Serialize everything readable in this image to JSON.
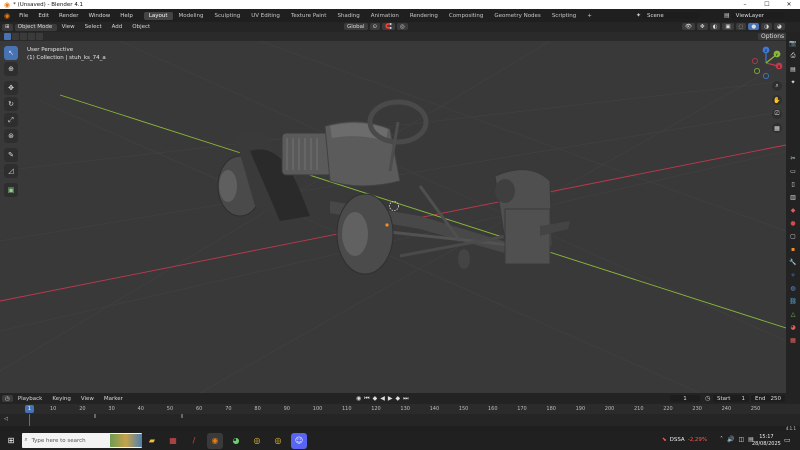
{
  "window": {
    "title": "* (Unsaved) - Blender 4.1",
    "controls": [
      "–",
      "☐",
      "✕"
    ]
  },
  "menubar": {
    "menus": [
      "File",
      "Edit",
      "Render",
      "Window",
      "Help"
    ],
    "workspaces": [
      "Layout",
      "Modeling",
      "Sculpting",
      "UV Editing",
      "Texture Paint",
      "Shading",
      "Animation",
      "Rendering",
      "Compositing",
      "Geometry Nodes",
      "Scripting"
    ],
    "active_workspace": "Layout",
    "add_tab": "+",
    "scene_label": "Scene",
    "view_layer_label": "ViewLayer"
  },
  "header3d": {
    "mode": "Object Mode",
    "menus": [
      "View",
      "Select",
      "Add",
      "Object"
    ],
    "orientation": "Global",
    "options_label": "Options"
  },
  "viewport": {
    "view_name": "User Perspective",
    "collection_info": "(1) Collection | stuh_ks_74_a",
    "nav_axes": [
      "X",
      "Y",
      "Z"
    ]
  },
  "timeline": {
    "menus": [
      "Playback",
      "Keying",
      "View",
      "Marker"
    ],
    "current_frame": "1",
    "start_label": "Start",
    "start_value": "1",
    "end_label": "End",
    "end_value": "250",
    "frame_marker": "1",
    "ruler_ticks": [
      "10",
      "20",
      "30",
      "40",
      "50",
      "60",
      "70",
      "80",
      "90",
      "100",
      "110",
      "120",
      "130",
      "140",
      "150",
      "160",
      "170",
      "180",
      "190",
      "200",
      "210",
      "220",
      "230",
      "240",
      "250"
    ]
  },
  "statusbar": {
    "version": "4.1.1"
  },
  "taskbar": {
    "search_placeholder": "Type here to search",
    "stock_name": "DSSA",
    "stock_change": "-2,29%",
    "time": "15:17",
    "date": "28/08/2025"
  },
  "colors": {
    "accent": "#4772b3",
    "viewport_bg": "#393939",
    "x_axis": "#c0394f",
    "y_axis": "#8ab83a",
    "z_axis": "#3f7bd4",
    "stock_negative": "#ff5a4f"
  }
}
